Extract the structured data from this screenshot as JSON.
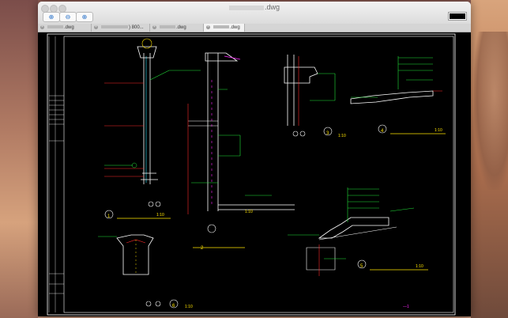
{
  "window": {
    "title_suffix": ".dwg"
  },
  "toolbar": {
    "zoom_in_glyph": "⊕",
    "zoom_fit_glyph": "⊖",
    "zoom_out_glyph": "⊕",
    "current_color": "#000000"
  },
  "tabs": [
    {
      "label": ".dwg",
      "active": false
    },
    {
      "label": ") 800...",
      "active": false
    },
    {
      "label": ".dwg",
      "active": false
    },
    {
      "label": ".dwg",
      "active": true
    }
  ],
  "drawing": {
    "scale_labels": [
      "1:10",
      "1:10",
      "1:10",
      "1:10",
      "1:10",
      "1:10",
      "1:10"
    ],
    "detail_numbers": [
      "1",
      "2",
      "3",
      "4",
      "5",
      "6"
    ],
    "sheet_number": "—1",
    "colors": {
      "background": "#000000",
      "frame": "#ffffff",
      "green": "#22e33a",
      "red": "#ff2b2b",
      "yellow": "#ffe400",
      "magenta": "#ff28ff",
      "cyan": "#29e6ff"
    }
  }
}
